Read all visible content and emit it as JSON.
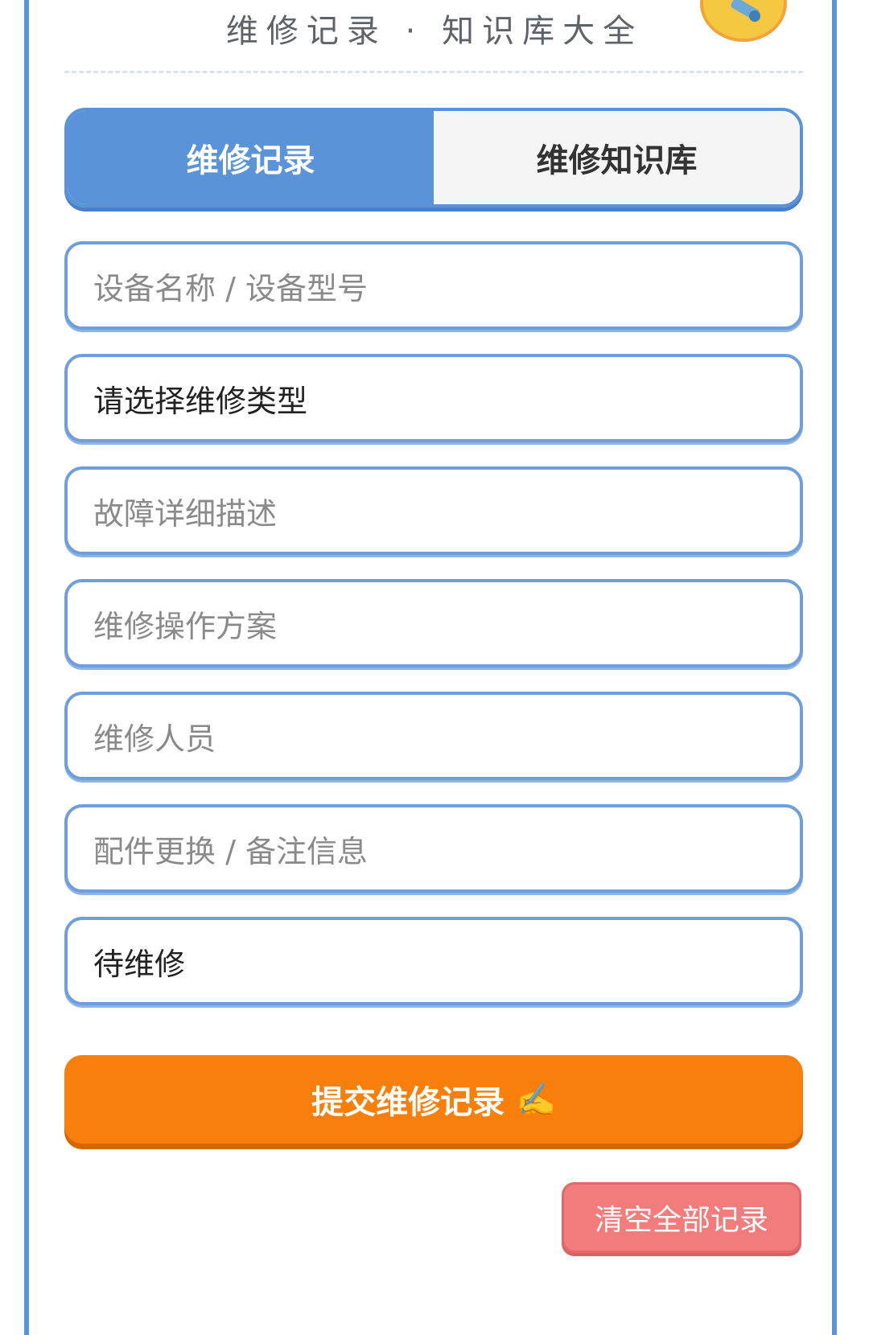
{
  "header": {
    "title": "维修记录 · 知识库大全"
  },
  "tabs": [
    {
      "label": "维修记录",
      "active": true
    },
    {
      "label": "维修知识库",
      "active": false
    }
  ],
  "form": {
    "device_placeholder": "设备名称 / 设备型号",
    "repair_type_value": "请选择维修类型",
    "fault_placeholder": "故障详细描述",
    "solution_placeholder": "维修操作方案",
    "staff_placeholder": "维修人员",
    "parts_placeholder": "配件更换 / 备注信息",
    "status_value": "待维修"
  },
  "actions": {
    "submit_label": "提交维修记录",
    "submit_emoji": "✍️",
    "clear_label": "清空全部记录"
  },
  "colors": {
    "primary_blue": "#5b93d9",
    "submit_orange": "#f97f0c",
    "clear_red": "#f27c7c"
  }
}
